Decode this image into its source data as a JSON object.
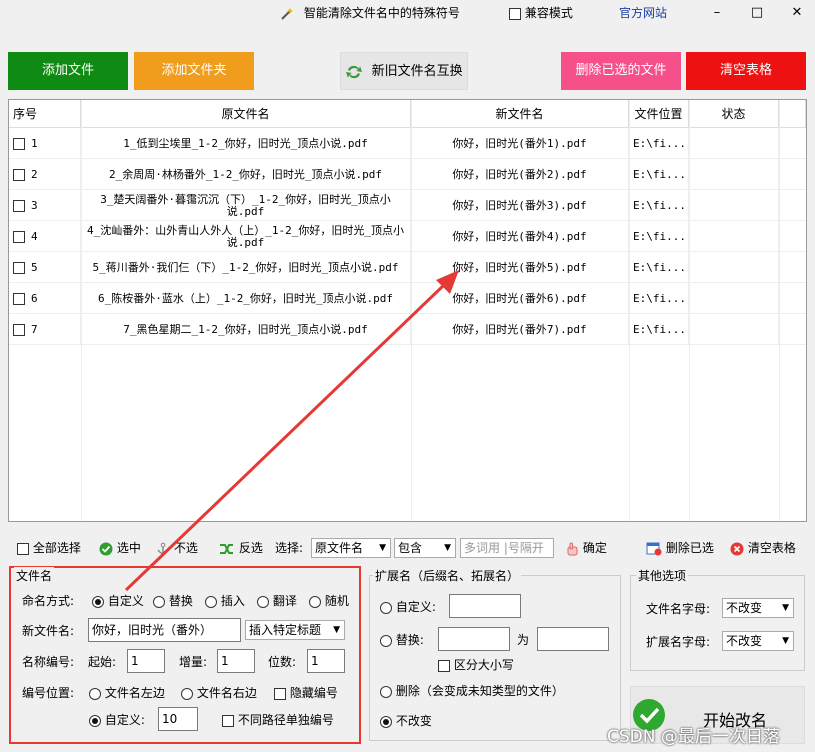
{
  "titlebar": {
    "app_title": "智能清除文件名中的特殊符号",
    "compat_label": "兼容模式",
    "website_label": "官方网站",
    "minimize": "–",
    "maximize": "□",
    "close": "✕"
  },
  "toolbar": {
    "add_file": "添加文件",
    "add_folder": "添加文件夹",
    "swap_names": "新旧文件名互换",
    "delete_selected": "删除已选的文件",
    "clear_table": "清空表格",
    "colors": {
      "add_file": "#0f8a12",
      "add_folder": "#f09c1c",
      "delete_selected": "#f5508a",
      "clear_table": "#ee1111"
    }
  },
  "table": {
    "headers": [
      "序号",
      "原文件名",
      "新文件名",
      "文件位置",
      "状态"
    ],
    "rows": [
      {
        "index": "1",
        "original": "1_低到尘埃里_1-2_你好，旧时光_顶点小说.pdf",
        "new": "你好，旧时光(番外1).pdf",
        "location": "E:\\fi...",
        "status": ""
      },
      {
        "index": "2",
        "original": "2_余周周·林杨番外_1-2_你好，旧时光_顶点小说.pdf",
        "new": "你好，旧时光(番外2).pdf",
        "location": "E:\\fi...",
        "status": ""
      },
      {
        "index": "3",
        "original": "3_楚天阔番外·暮霭沉沉（下）_1-2_你好，旧时光_顶点小说.pdf",
        "new": "你好，旧时光(番外3).pdf",
        "location": "E:\\fi...",
        "status": ""
      },
      {
        "index": "4",
        "original": "4_沈屾番外：山外青山人外人（上）_1-2_你好，旧时光_顶点小说.pdf",
        "new": "你好，旧时光(番外4).pdf",
        "location": "E:\\fi...",
        "status": ""
      },
      {
        "index": "5",
        "original": "5_蒋川番外·我们仨（下）_1-2_你好，旧时光_顶点小说.pdf",
        "new": "你好，旧时光(番外5).pdf",
        "location": "E:\\fi...",
        "status": ""
      },
      {
        "index": "6",
        "original": "6_陈桉番外·蓝水（上）_1-2_你好，旧时光_顶点小说.pdf",
        "new": "你好，旧时光(番外6).pdf",
        "location": "E:\\fi...",
        "status": ""
      },
      {
        "index": "7",
        "original": "7_黑色星期二_1-2_你好，旧时光_顶点小说.pdf",
        "new": "你好，旧时光(番外7).pdf",
        "location": "E:\\fi...",
        "status": ""
      }
    ]
  },
  "selection_bar": {
    "select_all": "全部选择",
    "select": "选中",
    "deselect": "不选",
    "invert": "反选",
    "select_label": "选择:",
    "field_value": "原文件名",
    "match_value": "包含",
    "keyword_placeholder": "多词用 |号隔开",
    "confirm": "确定",
    "delete_selected": "删除已选",
    "clear_table": "清空表格"
  },
  "filename_group": {
    "title": "文件名",
    "naming_label": "命名方式:",
    "naming_options": [
      "自定义",
      "替换",
      "插入",
      "翻译",
      "随机"
    ],
    "naming_selected": "自定义",
    "new_name_label": "新文件名:",
    "new_name_value": "你好，旧时光（番外）",
    "insert_title_value": "插入特定标题",
    "numbering_label": "名称编号:",
    "start_label": "起始:",
    "start_value": "1",
    "increment_label": "增量:",
    "increment_value": "1",
    "digits_label": "位数:",
    "digits_value": "1",
    "position_label": "编号位置:",
    "left_label": "文件名左边",
    "right_label": "文件名右边",
    "hide_number_label": "隐藏编号",
    "custom_label": "自定义:",
    "custom_value": "10",
    "separate_label": "不同路径单独编号"
  },
  "ext_group": {
    "title": "扩展名（后缀名、拓展名）",
    "custom_label": "自定义:",
    "replace_label": "替换:",
    "to_label": "为",
    "case_label": "区分大小写",
    "delete_label": "删除（会变成未知类型的文件）",
    "unchanged_label": "不改变"
  },
  "other_group": {
    "title": "其他选项",
    "filename_case_label": "文件名字母:",
    "filename_case_value": "不改变",
    "ext_case_label": "扩展名字母:",
    "ext_case_value": "不改变"
  },
  "start_button": "开始改名",
  "watermark": "CSDN @最后一次日落",
  "highlight_color": "#e53935"
}
